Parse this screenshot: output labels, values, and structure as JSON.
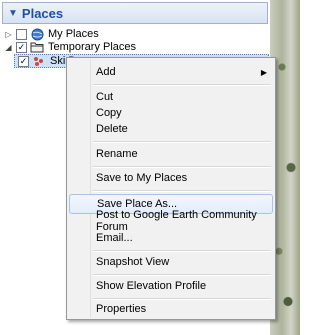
{
  "panel": {
    "title": "Places",
    "items": [
      {
        "label": "My Places",
        "checked": false,
        "icon": "globe-icon"
      },
      {
        "label": "Temporary Places",
        "checked": true,
        "icon": "folder-icon"
      },
      {
        "label": "Ski D",
        "checked": true,
        "icon": "placemark-icon"
      }
    ]
  },
  "menu": {
    "items": [
      {
        "label": "Add"
      },
      {
        "label": "Cut"
      },
      {
        "label": "Copy"
      },
      {
        "label": "Delete"
      },
      {
        "label": "Rename"
      },
      {
        "label": "Save to My Places"
      },
      {
        "label": "Save Place As..."
      },
      {
        "label": "Post to Google Earth Community Forum"
      },
      {
        "label": "Email..."
      },
      {
        "label": "Snapshot View"
      },
      {
        "label": "Show Elevation Profile"
      },
      {
        "label": "Properties"
      }
    ]
  }
}
